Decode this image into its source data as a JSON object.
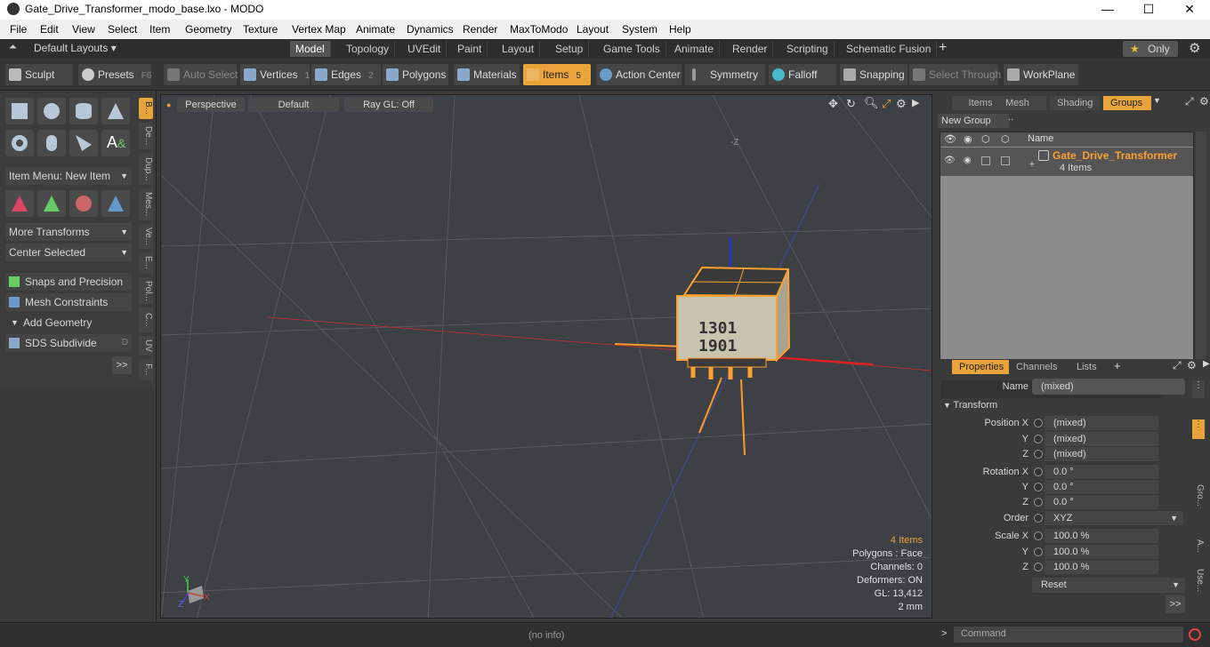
{
  "window": {
    "title": "Gate_Drive_Transformer_modo_base.lxo - MODO",
    "minimize": "—",
    "maximize": "☐",
    "close": "✕"
  },
  "menu": [
    "File",
    "Edit",
    "View",
    "Select",
    "Item",
    "Geometry",
    "Texture",
    "Vertex Map",
    "Animate",
    "Dynamics",
    "Render",
    "MaxToModo",
    "Layout",
    "System",
    "Help"
  ],
  "layoutbar": {
    "layouts_label": "Default Layouts ▾",
    "tabs": [
      "Model",
      "Topology",
      "UVEdit",
      "Paint",
      "Layout",
      "Setup",
      "Game Tools",
      "Animate",
      "Render",
      "Scripting",
      "Schematic Fusion"
    ],
    "active": "Model",
    "plus": "+",
    "only": "Only",
    "star": "★",
    "gear": "⚙"
  },
  "toolbar": {
    "sculpt": "Sculpt",
    "presets": "Presets",
    "presets_key": "F6",
    "auto_select": "Auto Select",
    "vertices": "Vertices",
    "vertices_key": "1",
    "edges": "Edges",
    "edges_key": "2",
    "polygons": "Polygons",
    "materials": "Materials",
    "items": "Items",
    "items_key": "5",
    "action_center": "Action Center",
    "symmetry": "Symmetry",
    "falloff": "Falloff",
    "snapping": "Snapping",
    "select_through": "Select Through",
    "workplane": "WorkPlane"
  },
  "left": {
    "item_menu": "Item Menu: New Item",
    "more_transforms": "More Transforms",
    "center_selected": "Center Selected",
    "snaps": "Snaps and Precision",
    "mesh_constraints": "Mesh Constraints",
    "add_geometry": "Add Geometry",
    "sds": "SDS Subdivide",
    "sds_key": "D",
    "more": ">>",
    "vtabs": [
      "B...",
      "De...",
      "Dup...",
      "Mes...",
      "Ve...",
      "E...",
      "Pol...",
      "C...",
      "UV",
      "F..."
    ]
  },
  "viewport": {
    "perspective": "Perspective",
    "default": "Default",
    "raygl": "Ray GL: Off",
    "neg_z": "-Z",
    "info": {
      "items": "4 Items",
      "polygons": "Polygons : Face",
      "channels": "Channels: 0",
      "deformers": "Deformers: ON",
      "gl": "GL: 13,412",
      "scale": "2 mm"
    },
    "part_text1": "1301",
    "part_text2": "1901",
    "axis_y": "Y",
    "axis_x": "X",
    "axis_z": "Z"
  },
  "rightpanel": {
    "tabs": [
      "Items",
      "Mesh ...",
      "Shading",
      "Groups"
    ],
    "active": "Groups",
    "new_group": "New Group",
    "col_name": "Name",
    "group_name": "Gate_Drive_Transformer",
    "group_count": "4 Items"
  },
  "props": {
    "tabs": [
      "Properties",
      "Channels",
      "Lists"
    ],
    "plus": "+",
    "name_label": "Name",
    "name_value": "(mixed)",
    "transform": "Transform",
    "position_label": "Position X",
    "y": "Y",
    "z": "Z",
    "pos": [
      "(mixed)",
      "(mixed)",
      "(mixed)"
    ],
    "rotation_label": "Rotation X",
    "rot": [
      "0.0 °",
      "0.0 °",
      "0.0 °"
    ],
    "order_label": "Order",
    "order": "XYZ",
    "scale_label": "Scale X",
    "scale": [
      "100.0 %",
      "100.0 %",
      "100.0 %"
    ],
    "reset": "Reset",
    "more": ">>",
    "side_tabs": [
      "Gro...",
      "A...",
      "Use..."
    ]
  },
  "status": {
    "info": "(no info)",
    "command": "Command",
    "prompt": ">"
  }
}
